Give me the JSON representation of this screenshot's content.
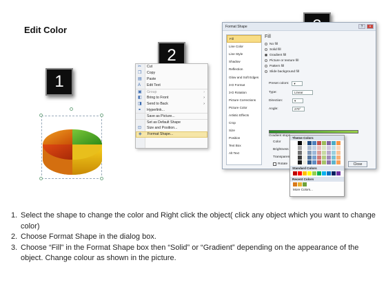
{
  "title": "Edit Color",
  "steps": [
    "1",
    "2",
    "3"
  ],
  "context_menu": {
    "items": [
      {
        "label": "Cut",
        "icon": "cut-icon"
      },
      {
        "label": "Copy",
        "icon": "copy-icon"
      },
      {
        "label": "Paste",
        "icon": "paste-icon"
      },
      {
        "label": "Edit Text",
        "icon": "edit-text-icon"
      },
      {
        "label": "Group",
        "icon": "group-icon"
      },
      {
        "label": "Bring to Front",
        "icon": "bring-front-icon"
      },
      {
        "label": "Send to Back",
        "icon": "send-back-icon"
      },
      {
        "label": "Hyperlink...",
        "icon": "hyperlink-icon"
      },
      {
        "label": "Save as Picture...",
        "icon": ""
      },
      {
        "label": "Set as Default Shape",
        "icon": ""
      },
      {
        "label": "Size and Position...",
        "icon": "size-icon"
      },
      {
        "label": "Format Shape...",
        "icon": "format-shape-icon"
      }
    ]
  },
  "dialog": {
    "title": "Format Shape",
    "categories": [
      "Fill",
      "Line Color",
      "Line Style",
      "Shadow",
      "Reflection",
      "Glow and Soft Edges",
      "3-D Format",
      "3-D Rotation",
      "Picture Corrections",
      "Picture Color",
      "Artistic Effects",
      "Crop",
      "Size",
      "Position",
      "Text Box",
      "Alt Text"
    ],
    "pane_heading": "Fill",
    "fill_options": [
      "No fill",
      "Solid fill",
      "Gradient fill",
      "Picture or texture fill",
      "Pattern fill",
      "Slide background fill"
    ],
    "selected_fill": 2,
    "preset_colors_label": "Preset colors:",
    "type_label": "Type:",
    "type_value": "Linear",
    "direction_label": "Direction:",
    "angle_label": "Angle:",
    "angle_value": "270°",
    "gradient_stops_label": "Gradient stops",
    "color_label": "Color",
    "position_label": "Position:",
    "position_value": "100%",
    "brightness_label": "Brightness",
    "transparency_label": "Transparen",
    "rotate_label": "Rotate",
    "close_label": "Close"
  },
  "palette": {
    "theme_label": "Theme Colors",
    "standard_label": "Standard Colors",
    "recent_label": "Recent Colors",
    "more_label": "More Colors...",
    "theme_top": [
      "#ffffff",
      "#000000",
      "#eeece1",
      "#1f497d",
      "#4f81bd",
      "#c0504d",
      "#9bbb59",
      "#8064a2",
      "#4bacc6",
      "#f79646"
    ],
    "standard": [
      "#c00000",
      "#ff0000",
      "#ffc000",
      "#ffff00",
      "#92d050",
      "#00b050",
      "#00b0f0",
      "#0070c0",
      "#002060",
      "#7030a0"
    ],
    "recent": [
      "#d97a1a",
      "#e8b030",
      "#6fa33a"
    ]
  },
  "instructions": [
    {
      "num": "1.",
      "text": "Select the shape to change the color and Right click the object( click any object which you want to change color)"
    },
    {
      "num": "2.",
      "text": "Choose Format Shape in the dialog box."
    },
    {
      "num": "3.",
      "text": "Choose “Fill” in the Format Shape box then “Solid” or “Gradient” depending on the appearance of the object. Change colour as shown in the picture."
    }
  ]
}
